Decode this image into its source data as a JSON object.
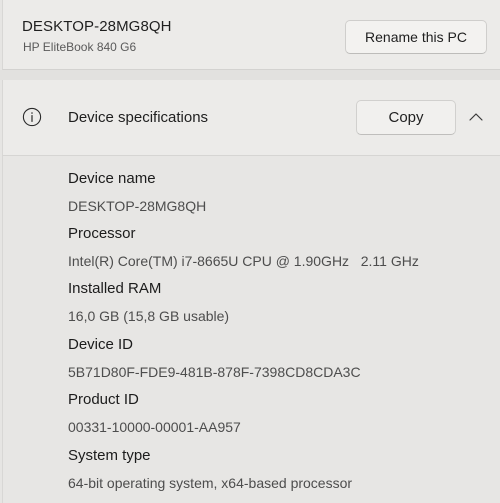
{
  "header": {
    "pc_name": "DESKTOP-28MG8QH",
    "model": "HP EliteBook 840 G6",
    "rename_label": "Rename this PC"
  },
  "device_specs": {
    "title": "Device specifications",
    "copy_label": "Copy",
    "icon": "info-icon",
    "expand_icon": "chevron-up-icon",
    "items": [
      {
        "label": "Device name",
        "value": "DESKTOP-28MG8QH"
      },
      {
        "label": "Processor",
        "value": "Intel(R) Core(TM) i7-8665U CPU @ 1.90GHz   2.11 GHz"
      },
      {
        "label": "Installed RAM",
        "value": "16,0 GB (15,8 GB usable)"
      },
      {
        "label": "Device ID",
        "value": "5B71D80F-FDE9-481B-878F-7398CD8CDA3C"
      },
      {
        "label": "Product ID",
        "value": "00331-10000-00001-AA957"
      },
      {
        "label": "System type",
        "value": "64-bit operating system, x64-based processor"
      }
    ]
  }
}
